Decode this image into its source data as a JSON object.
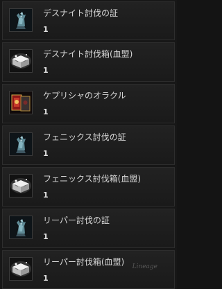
{
  "items": [
    {
      "name": "デスナイト討伐の証",
      "qty": "1",
      "icon": "dragon-statue-icon"
    },
    {
      "name": "デスナイト討伐箱(血盟)",
      "qty": "1",
      "icon": "silver-chest-icon"
    },
    {
      "name": "ケプリシャのオラクル",
      "qty": "1",
      "icon": "oracle-cards-icon"
    },
    {
      "name": "フェニックス討伐の証",
      "qty": "1",
      "icon": "dragon-statue-icon"
    },
    {
      "name": "フェニックス討伐箱(血盟)",
      "qty": "1",
      "icon": "silver-chest-icon"
    },
    {
      "name": "リーパー討伐の証",
      "qty": "1",
      "icon": "dragon-statue-icon"
    },
    {
      "name": "リーパー討伐箱(血盟)",
      "qty": "1",
      "icon": "silver-chest-icon"
    }
  ],
  "watermark": "Lineage"
}
